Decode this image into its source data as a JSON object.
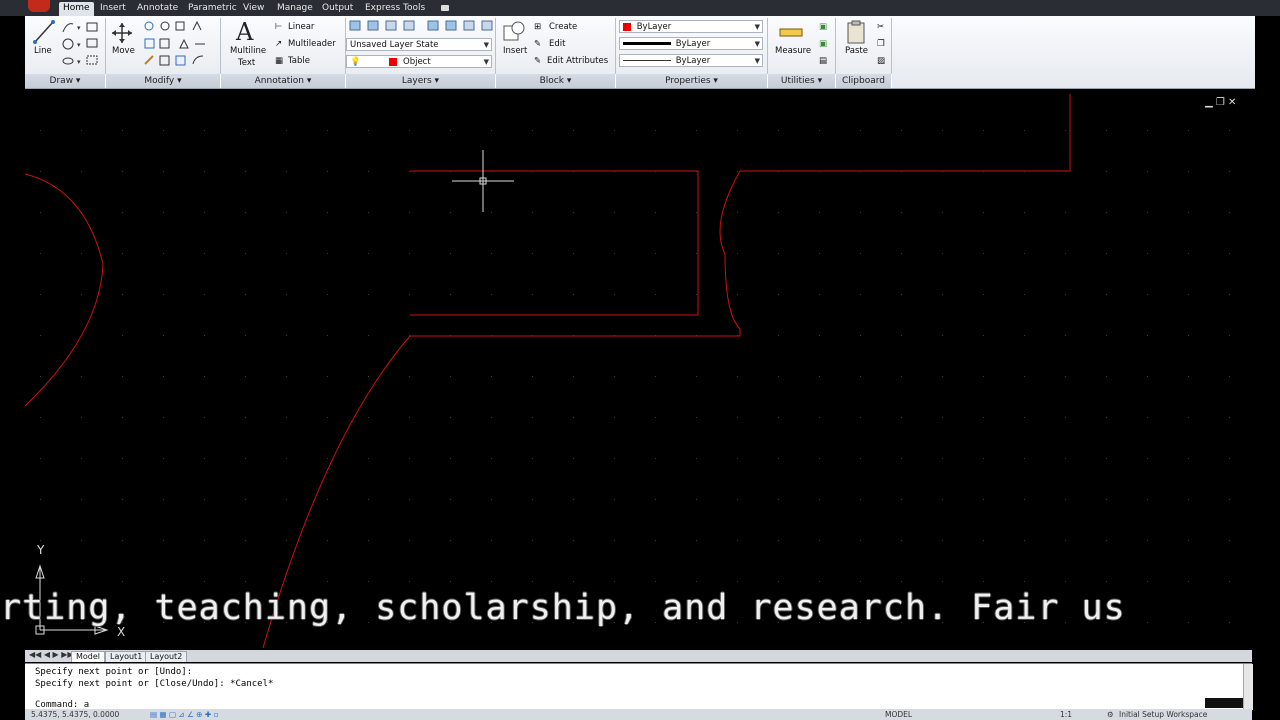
{
  "tabs": [
    "Home",
    "Insert",
    "Annotate",
    "Parametric",
    "View",
    "Manage",
    "Output",
    "Express Tools"
  ],
  "panels": {
    "draw": {
      "title": "Draw ▾",
      "line": "Line"
    },
    "modify": {
      "title": "Modify ▾",
      "move": "Move"
    },
    "annotation": {
      "title": "Annotation ▾",
      "multiline": "Multiline",
      "text": "Text",
      "linear": "Linear",
      "multileader": "Multileader",
      "table": "Table"
    },
    "layers": {
      "title": "Layers ▾",
      "layer_state": "Unsaved Layer State",
      "object": "Object"
    },
    "block": {
      "title": "Block ▾",
      "insert": "Insert",
      "create": "Create",
      "edit": "Edit",
      "edit_attributes": "Edit Attributes"
    },
    "properties": {
      "title": "Properties ▾",
      "color": "ByLayer",
      "lineweight": "ByLayer",
      "linetype": "ByLayer"
    },
    "utilities": {
      "title": "Utilities ▾",
      "measure": "Measure"
    },
    "clipboard": {
      "title": "Clipboard",
      "paste": "Paste"
    }
  },
  "caption": "rting, teaching, scholarship, and research. Fair us",
  "ucs": {
    "y": "Y",
    "x": "X"
  },
  "layout_tabs": [
    "Model",
    "Layout1",
    "Layout2"
  ],
  "command_history": [
    "Specify next point or [Undo]:",
    "Specify next point or [Close/Undo]: *Cancel*"
  ],
  "command_prompt": "Command: a",
  "status": {
    "coords": "5.4375, 5.4375, 0.0000",
    "model": "MODEL",
    "scale": "1:1",
    "workspace": "Initial Setup Workspace"
  },
  "colors": {
    "accent": "#c42a1c",
    "geometry": "#d01010",
    "ribbon": "#e5e9ef"
  }
}
